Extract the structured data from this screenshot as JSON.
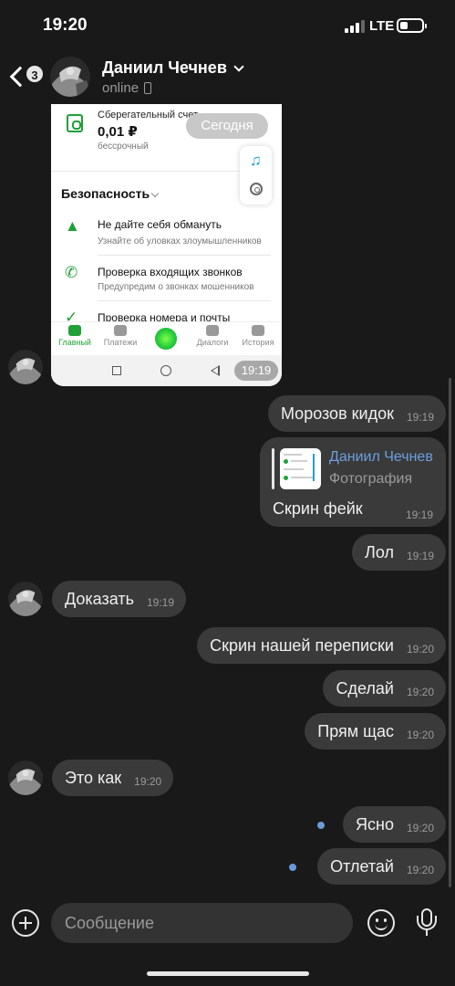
{
  "status_bar": {
    "time": "19:20",
    "network": "LTE"
  },
  "header": {
    "unread_count": "3",
    "contact_name": "Даниил Чечнев",
    "status": "online"
  },
  "photo_screenshot": {
    "account_title": "Сберегательный счет",
    "account_amount": "0,01 ₽",
    "account_term": "бессрочный",
    "date_pill": "Сегодня",
    "section_title": "Безопасность",
    "rows": [
      {
        "title": "Не дайте себя обмануть",
        "subtitle": "Узнайте об уловках злоумышленников"
      },
      {
        "title": "Проверка входящих звонков",
        "subtitle": "Предупредим о звонках мошенников"
      },
      {
        "title": "Проверка номера и почты",
        "subtitle": ""
      }
    ],
    "nav": [
      "Главный",
      "Платежи",
      "Диалоги",
      "История"
    ],
    "time": "19:19"
  },
  "messages": [
    {
      "text": "Морозов кидок",
      "time": "19:19"
    },
    {
      "reply_author": "Даниил Чечнев",
      "reply_type": "Фотография",
      "text": "Скрин фейк",
      "time": "19:19"
    },
    {
      "text": "Лол",
      "time": "19:19"
    },
    {
      "text": "Доказать",
      "time": "19:19"
    },
    {
      "text": "Скрин нашей переписки",
      "time": "19:20"
    },
    {
      "text": "Сделай",
      "time": "19:20"
    },
    {
      "text": "Прям щас",
      "time": "19:20"
    },
    {
      "text": "Это как",
      "time": "19:20"
    },
    {
      "text": "Ясно",
      "time": "19:20"
    },
    {
      "text": "Отлетай",
      "time": "19:20"
    }
  ],
  "composer": {
    "placeholder": "Сообщение"
  },
  "colors": {
    "background": "#191919",
    "bubble": "#3a3a3a",
    "accent_blue": "#6d9fe0",
    "sber_green": "#21a038"
  }
}
